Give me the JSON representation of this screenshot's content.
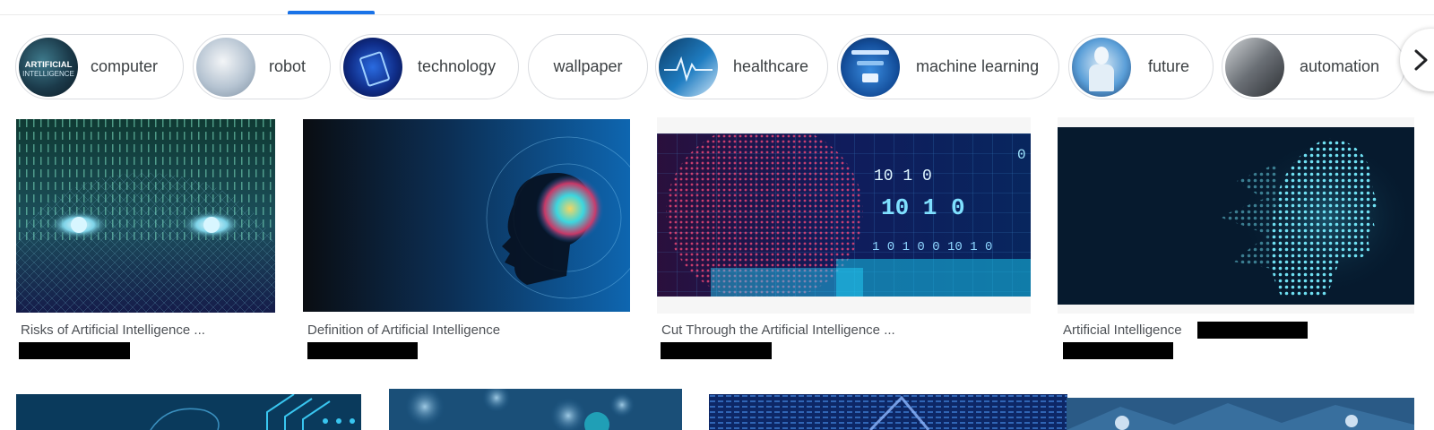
{
  "chips": [
    {
      "label": "computer",
      "thumb_text": [
        "ARTIFICIAL",
        "INTELLIGENCE"
      ]
    },
    {
      "label": "robot"
    },
    {
      "label": "technology"
    },
    {
      "label": "wallpaper"
    },
    {
      "label": "healthcare"
    },
    {
      "label": "machine learning"
    },
    {
      "label": "future"
    },
    {
      "label": "automation"
    }
  ],
  "results": [
    {
      "title": "Risks of Artificial Intelligence ..."
    },
    {
      "title": "Definition of Artificial Intelligence"
    },
    {
      "title": "Cut Through the Artificial Intelligence ...",
      "image_text": [
        "0",
        "10 1 0",
        "10 1 0",
        "1 0 1 0 0 10 1 0"
      ]
    },
    {
      "title": "Artificial Intelligence"
    }
  ],
  "icons": {
    "scroll_next": "chevron-right-icon"
  },
  "colors": {
    "tab_indicator": "#1a73e8",
    "chip_border": "#dadce0",
    "title_text": "#4d5156",
    "redaction": "#000000"
  }
}
